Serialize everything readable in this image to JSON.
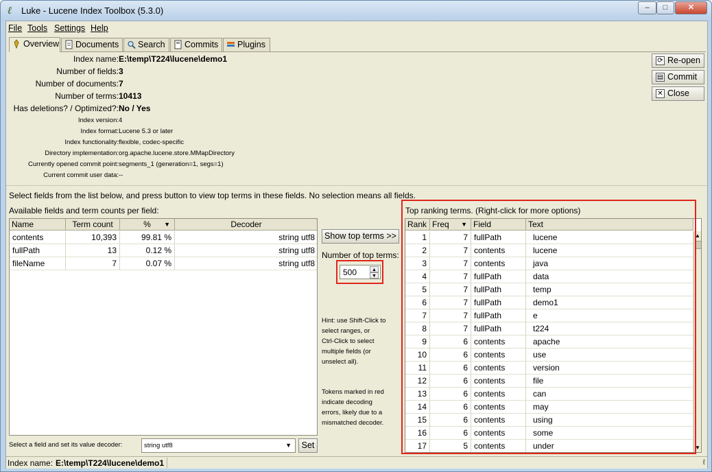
{
  "window": {
    "title": "Luke - Lucene Index Toolbox (5.3.0)",
    "controls": {
      "minimize": "–",
      "maximize": "□",
      "close": "✕"
    }
  },
  "menu": [
    "File",
    "Tools",
    "Settings",
    "Help"
  ],
  "tabs": [
    "Overview",
    "Documents",
    "Search",
    "Commits",
    "Plugins"
  ],
  "overview": {
    "index_name_label": "Index name:",
    "index_name": "E:\\temp\\T224\\lucene\\demo1",
    "num_fields_label": "Number of fields:",
    "num_fields": "3",
    "num_docs_label": "Number of documents:",
    "num_docs": "7",
    "num_terms_label": "Number of terms:",
    "num_terms": "10413",
    "deletions_label": "Has deletions? / Optimized?:",
    "deletions": "No / Yes",
    "index_version_label": "Index version:",
    "index_version": "4",
    "index_format_label": "Index format:",
    "index_format": "Lucene 5.3 or later",
    "functionality_label": "Index functionality:",
    "functionality": "flexible, codec-specific",
    "directory_label": "Directory implementation:",
    "directory": "org.apache.lucene.store.MMapDirectory",
    "commit_point_label": "Currently opened commit point:",
    "commit_point": "segments_1 (generation=1, segs=1)",
    "commit_user_label": "Current commit user data:",
    "commit_user": "--"
  },
  "side_buttons": {
    "reopen": "Re-open",
    "commit": "Commit",
    "close": "Close"
  },
  "instructions": "Select fields from the list below, and press button to view top terms in these fields. No selection means all fields.",
  "fields_panel": {
    "title": "Available fields and term counts per field:",
    "columns": [
      "Name",
      "Term count",
      "%",
      "Decoder"
    ],
    "rows": [
      {
        "name": "contents",
        "count": "10,393",
        "pct": "99.81 %",
        "decoder": "string utf8"
      },
      {
        "name": "fullPath",
        "count": "13",
        "pct": "0.12 %",
        "decoder": "string utf8"
      },
      {
        "name": "fileName",
        "count": "7",
        "pct": "0.07 %",
        "decoder": "string utf8"
      }
    ],
    "decoder_label": "Select a field and set its value decoder:",
    "decoder_value": "string utf8",
    "set_button": "Set"
  },
  "middle": {
    "show_top_button": "Show top terms >>",
    "num_top_label": "Number of top terms:",
    "num_top_value": "500",
    "hint1": "Hint: use Shift-Click to\nselect ranges, or\nCtrl-Click to select\nmultiple fields (or\nunselect all).",
    "hint2": "Tokens marked in red\nindicate decoding\nerrors, likely due to a\nmismatched decoder."
  },
  "top_terms": {
    "title": "Top ranking terms. (Right-click for more options)",
    "columns": [
      "Rank",
      "Freq",
      "Field",
      "Text"
    ],
    "rows": [
      {
        "rank": "1",
        "freq": "7",
        "field": "fullPath",
        "text": "lucene"
      },
      {
        "rank": "2",
        "freq": "7",
        "field": "contents",
        "text": "lucene"
      },
      {
        "rank": "3",
        "freq": "7",
        "field": "contents",
        "text": "java"
      },
      {
        "rank": "4",
        "freq": "7",
        "field": "fullPath",
        "text": "data"
      },
      {
        "rank": "5",
        "freq": "7",
        "field": "fullPath",
        "text": "temp"
      },
      {
        "rank": "6",
        "freq": "7",
        "field": "fullPath",
        "text": "demo1"
      },
      {
        "rank": "7",
        "freq": "7",
        "field": "fullPath",
        "text": "e"
      },
      {
        "rank": "8",
        "freq": "7",
        "field": "fullPath",
        "text": "t224"
      },
      {
        "rank": "9",
        "freq": "6",
        "field": "contents",
        "text": "apache"
      },
      {
        "rank": "10",
        "freq": "6",
        "field": "contents",
        "text": "use"
      },
      {
        "rank": "11",
        "freq": "6",
        "field": "contents",
        "text": "version"
      },
      {
        "rank": "12",
        "freq": "6",
        "field": "contents",
        "text": "file"
      },
      {
        "rank": "13",
        "freq": "6",
        "field": "contents",
        "text": "can"
      },
      {
        "rank": "14",
        "freq": "6",
        "field": "contents",
        "text": "may"
      },
      {
        "rank": "15",
        "freq": "6",
        "field": "contents",
        "text": "using"
      },
      {
        "rank": "16",
        "freq": "6",
        "field": "contents",
        "text": "some"
      },
      {
        "rank": "17",
        "freq": "5",
        "field": "contents",
        "text": "under"
      }
    ]
  },
  "status": {
    "label": "Index name:",
    "value": "E:\\temp\\T224\\lucene\\demo1"
  },
  "colors": {
    "highlight": "#e0251c",
    "panel": "#ecebd8",
    "titlebar": "#bcd3ea"
  }
}
